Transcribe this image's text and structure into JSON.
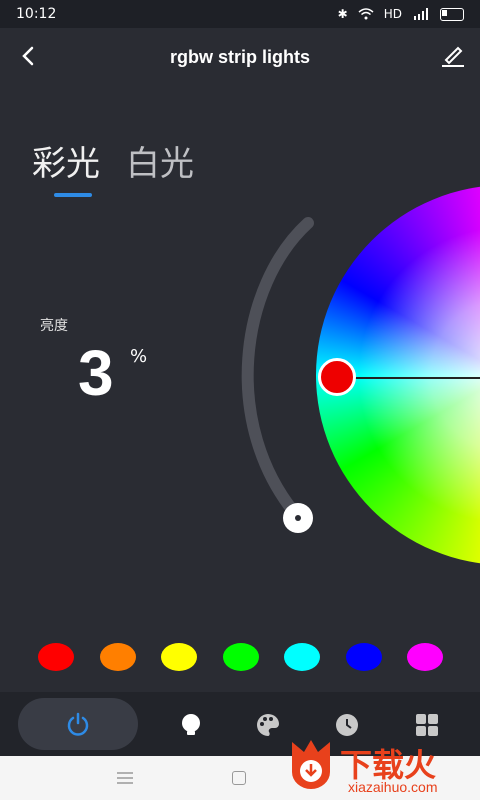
{
  "status_bar": {
    "time": "10:12",
    "network": "HD"
  },
  "header": {
    "title": "rgbw strip lights"
  },
  "tabs": [
    {
      "label": "彩光",
      "active": true
    },
    {
      "label": "白光",
      "active": false
    }
  ],
  "brightness": {
    "label": "亮度",
    "value": "3",
    "unit": "%",
    "level_percent": 3
  },
  "color_wheel": {
    "selected_color": "#ff0000"
  },
  "swatches": [
    "#ff0000",
    "#ff7f00",
    "#ffff00",
    "#00ff00",
    "#00ffff",
    "#0000ff",
    "#ff00ff"
  ],
  "nav": {
    "items": [
      "power-icon",
      "bulb-icon",
      "palette-icon",
      "clock-icon",
      "grid-icon"
    ],
    "accent": "#2e8be6"
  },
  "watermark": {
    "text": "下载火",
    "sub": "xiazaihuo.com"
  }
}
